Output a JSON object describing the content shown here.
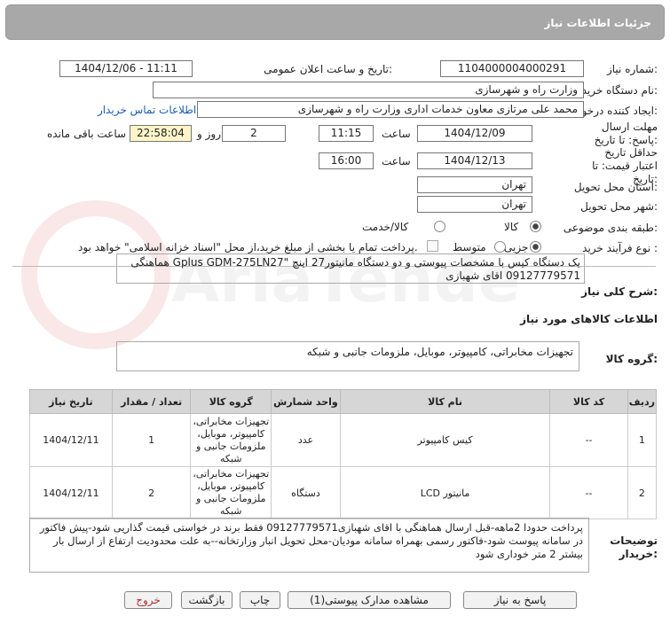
{
  "header": {
    "title": "جزئیات اطلاعات نیاز"
  },
  "labels": {
    "need_number": "شماره نیاز:",
    "announce_datetime": "تاریخ و ساعت اعلان عمومی:",
    "buyer_org": "نام دستگاه خریدار:",
    "requester": "ایجاد کننده درخواست:",
    "contact_link": "اطلاعات تماس خریدار",
    "reply_deadline": "مهلت ارسال پاسخ: تا تاریخ:",
    "time": "ساعت",
    "day_and": "روز و",
    "remaining": "ساعت باقی مانده",
    "price_validity": "حداقل تاریخ اعتبار قیمت: تا تاریخ:",
    "province": "استان محل تحویل:",
    "city": "شهر محل تحویل:",
    "category": "طبقه بندی موضوعی:",
    "process_type": "نوع فرآیند خرید :",
    "general_desc": "شرح کلی نیاز:",
    "goods_info": "اطلاعات کالاهای مورد نیاز",
    "goods_group": "گروه کالا:",
    "buyer_notes": "توضیحات خریدار:"
  },
  "values": {
    "need_number": "1104000004000291",
    "announce_datetime": "1404/12/06 - 11:11",
    "buyer_org": "وزارت راه و شهرسازی",
    "requester": "محمد علی  مرتازی معاون خدمات اداری وزارت راه و شهرسازی",
    "reply_date": "1404/12/09",
    "reply_time": "11:15",
    "days": "2",
    "remaining_time": "22:58:04",
    "validity_date": "1404/12/13",
    "validity_time": "16:00",
    "province": "تهران",
    "city": "تهران",
    "general_desc": "یک دستگاه کیس با مشخصات پیوستی و دو دستگاه مانیتور27 اینچ \"Gplus GDM-275LN27 هماهنگی 09127779571 اقای شهبازی",
    "goods_group": "تجهیزات مخابراتی، کامپیوتر، موبایل، ملزومات جانبی و شبکه",
    "buyer_notes": "پرداخت حدودا 2ماهه-قبل ارسال هماهنگی با اقای شهبازی09127779571 فقط برند در خواستی قیمت گذاریی شود-پیش فاکتور در سامانه پیوست شود-فاکتور رسمی بهمراه سامانه مودیان-محل تحویل انبار وزارتخانه--به علت محدودیت ارتفاع از ارسال بار بیشتر 2 متر خوداری شود"
  },
  "category_options": {
    "goods": "کالا",
    "goods_service": "کالا/خدمت",
    "selected": "کالا"
  },
  "process_options": {
    "partial": "جزیی",
    "medium": "متوسط",
    "selected": "جزیی",
    "payment_note": "پرداخت تمام یا بخشی از مبلغ خرید،از محل \"اسناد خزانه اسلامی\" خواهد بود."
  },
  "table": {
    "headers": [
      "ردیف",
      "کد کالا",
      "نام کالا",
      "واحد شمارش",
      "گروه کالا",
      "تعداد / مقدار",
      "تاریخ نیاز"
    ],
    "rows": [
      [
        "1",
        "--",
        "کیس کامپیوتر",
        "عدد",
        "تجهیزات مخابراتی، کامپیوتر، موبایل، ملزومات جانبی و شبکه",
        "1",
        "1404/12/11"
      ],
      [
        "2",
        "--",
        "مانیتور LCD",
        "دستگاه",
        "تجهیزات مخابراتی، کامپیوتر، موبایل، ملزومات جانبی و شبکه",
        "2",
        "1404/12/11"
      ]
    ]
  },
  "buttons": {
    "reply": "پاسخ به نیاز",
    "view_docs": "مشاهده مدارک پیوستی(1)",
    "print": "چاپ",
    "back": "بازگشت",
    "exit": "خروج"
  },
  "watermark": "AriaTender.neT",
  "colors": {
    "header_bg": "#a8a8a8",
    "link": "#1a5fb4",
    "remaining_bg": "#fff5c8",
    "exit_text": "#b03030"
  }
}
